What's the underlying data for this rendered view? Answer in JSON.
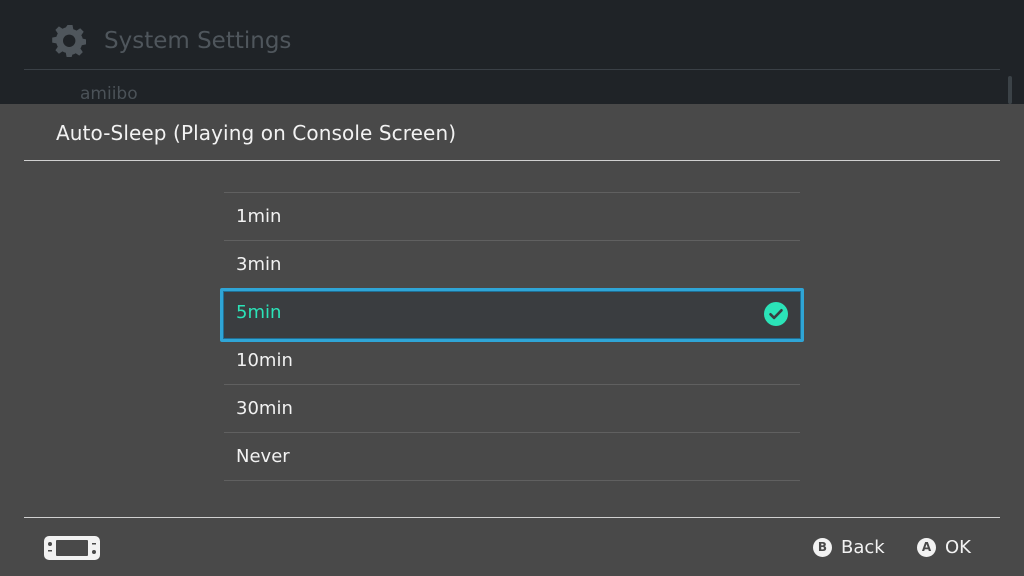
{
  "background": {
    "title": "System Settings",
    "icon": "gear-icon",
    "item": "amiibo"
  },
  "dialog": {
    "title": "Auto-Sleep (Playing on Console Screen)",
    "options": [
      {
        "label": "1min",
        "selected": false
      },
      {
        "label": "3min",
        "selected": false
      },
      {
        "label": "5min",
        "selected": true
      },
      {
        "label": "10min",
        "selected": false
      },
      {
        "label": "30min",
        "selected": false
      },
      {
        "label": "Never",
        "selected": false
      }
    ],
    "selected_color": "#2be3b8",
    "focus_color": "#2fa5d6"
  },
  "footer": {
    "device_icon": "handheld-console-icon",
    "back": {
      "key": "B",
      "label": "Back"
    },
    "ok": {
      "key": "A",
      "label": "OK"
    }
  }
}
